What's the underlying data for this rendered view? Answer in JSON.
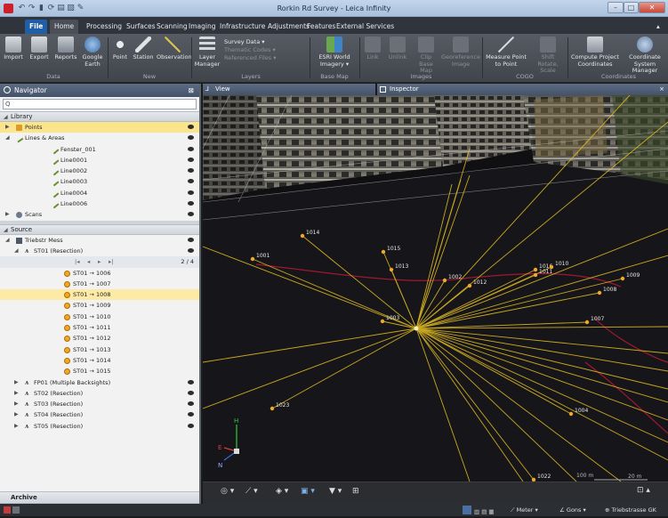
{
  "window": {
    "title": "Rorkin Rd Survey - Leica Infinity"
  },
  "tabs": [
    "File",
    "Home",
    "Processing",
    "Surfaces",
    "Scanning",
    "Imaging",
    "Infrastructure",
    "Adjustments",
    "Features",
    "External Services"
  ],
  "ribbon": {
    "data_group": "Data",
    "import": "Import",
    "export": "Export",
    "reports": "Reports",
    "google_earth": "Google Earth",
    "new_group": "New",
    "point": "Point",
    "station": "Station",
    "observation": "Observation",
    "layers_group": "Layers",
    "layer_manager": "Layer Manager",
    "survey_data": "Survey Data",
    "thematic_codes": "Thematic Codes",
    "referenced_files": "Referenced Files",
    "base_map_group": "Base Map",
    "esri": "ESRI World Imagery",
    "images_group": "Images",
    "link": "Link",
    "unlink": "Unlink",
    "clip_base_map": "Clip Base Map",
    "georeference_image": "Georeference Image",
    "cogo_group": "COGO",
    "measure": "Measure Point to Point",
    "shift": "Shift Rotate, Scale",
    "coordinates_group": "Coordinates",
    "compute": "Compute Project Coordinates",
    "coord_system": "Coordinate System Manager"
  },
  "navigator": {
    "title": "Navigator",
    "pin": "⊠",
    "search_icon": "Q",
    "library_label": "Library",
    "points_label": "Points",
    "lines_areas_label": "Lines & Areas",
    "lines": [
      "Fenster_001",
      "Line0001",
      "Line0002",
      "Line0003",
      "Line0004",
      "Line0006"
    ],
    "scans_label": "Scans",
    "source_label": "Source",
    "source_root": "Triebstr Mess",
    "station_label": "ST01 (Resection)",
    "pager": {
      "first": "|◂",
      "prev": "◂",
      "next": "▸",
      "last": "▸|",
      "position": "2 / 4"
    },
    "observations": [
      "ST01 → 1006",
      "ST01 → 1007",
      "ST01 → 1008",
      "ST01 → 1009",
      "ST01 → 1010",
      "ST01 → 1011",
      "ST01 → 1012",
      "ST01 → 1013",
      "ST01 → 1014",
      "ST01 → 1015"
    ],
    "other_stations": [
      "FP01 (Multiple Backsights)",
      "ST02 (Resection)",
      "ST03 (Resection)",
      "ST04 (Resection)",
      "ST05 (Resection)"
    ],
    "archive_label": "Archive"
  },
  "view": {
    "title": "View",
    "inspector": "Inspector",
    "close": "×",
    "points": [
      {
        "label": "1014"
      },
      {
        "label": "1001"
      },
      {
        "label": "1015"
      },
      {
        "label": "1013"
      },
      {
        "label": "1002"
      },
      {
        "label": "1012"
      },
      {
        "label": "1016"
      },
      {
        "label": "1010"
      },
      {
        "label": "1011"
      },
      {
        "label": "1009"
      },
      {
        "label": "1008"
      },
      {
        "label": "1003"
      },
      {
        "label": "1007"
      },
      {
        "label": "1023"
      },
      {
        "label": "1004"
      },
      {
        "label": "1022"
      }
    ],
    "axes": {
      "h": "H",
      "e": "E",
      "n": "N"
    },
    "scale_100": "100 m",
    "scale_20": "20 m"
  },
  "statusbar": {
    "unit_distance": "Meter",
    "unit_angle": "Gons",
    "coord_system": "Triebstrasse GK"
  },
  "colors": {
    "accent": "#f0a82a",
    "selection": "#fbe58c",
    "panel_header": "#45536a",
    "line_yellow": "#e8c020",
    "curve_red": "#a01830"
  }
}
